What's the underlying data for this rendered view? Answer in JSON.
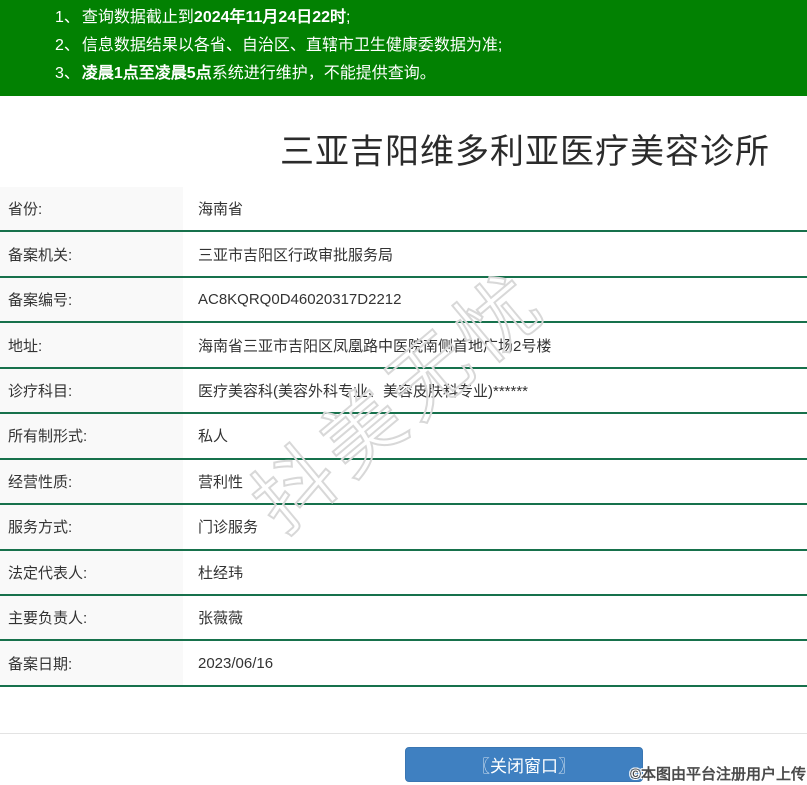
{
  "colors": {
    "header_green": "#028102",
    "line_green": "#17714c",
    "label_bg": "#f9f9f9",
    "text_dark": "#333333",
    "title_color": "#2b2b2b",
    "button_blue": "#3f80c1",
    "watermark_gray": "#d8d8d8",
    "divider_gray": "#e3e3e3"
  },
  "notices": [
    {
      "num": "1、",
      "parts": {
        "pre": "查询数据截止到",
        "bold": "2024年11月24日22时",
        "post": ";"
      }
    },
    {
      "num": "2、",
      "parts": {
        "pre": "信息数据结果以各省、自治区、直辖市卫生健康委数据为准;",
        "bold": "",
        "post": ""
      }
    },
    {
      "num": "3、",
      "parts": {
        "pre": "",
        "bold": "凌晨1点至凌晨5点",
        "post": "系统进行维护，不能提供查询。"
      }
    }
  ],
  "title": "三亚吉阳维多利亚医疗美容诊所",
  "table": {
    "rows": [
      {
        "label": "省份:",
        "value": "海南省"
      },
      {
        "label": "备案机关:",
        "value": "三亚市吉阳区行政审批服务局"
      },
      {
        "label": "备案编号:",
        "value": "AC8KQRQ0D46020317D2212"
      },
      {
        "label": "地址:",
        "value": "海南省三亚市吉阳区凤凰路中医院南侧首地广场2号楼"
      },
      {
        "label": "诊疗科目:",
        "value": "医疗美容科(美容外科专业、美容皮肤科专业)******"
      },
      {
        "label": "所有制形式:",
        "value": "私人"
      },
      {
        "label": "经营性质:",
        "value": "营利性"
      },
      {
        "label": "服务方式:",
        "value": "门诊服务"
      },
      {
        "label": "法定代表人:",
        "value": "杜经玮"
      },
      {
        "label": "主要负责人:",
        "value": "张薇薇"
      },
      {
        "label": "备案日期:",
        "value": "2023/06/16"
      }
    ]
  },
  "watermark": "抖美无忧",
  "footer": {
    "close_button_label": "〖关闭窗口〗",
    "upload_note": "©本图由平台注册用户上传"
  }
}
